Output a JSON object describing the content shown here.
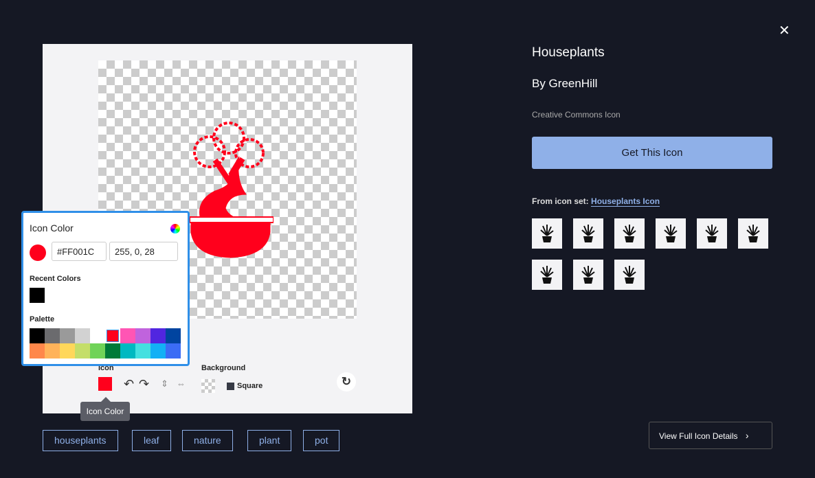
{
  "close_icon": "close-icon",
  "preview": {
    "icon_color": "#FF001C",
    "icon_label": "Icon",
    "background_label": "Background",
    "shape_label": "Square",
    "tooltip": "Icon Color"
  },
  "color_popup": {
    "title": "Icon Color",
    "hex": "#FF001C",
    "rgb": "255, 0, 28",
    "recent_label": "Recent Colors",
    "recent": [
      "#000000"
    ],
    "palette_label": "Palette",
    "palette": [
      "#000000",
      "#6b6b6e",
      "#9a9a9a",
      "#d2d2d2",
      "#ffffff",
      "#ff001c",
      "#ff55b4",
      "#c063dd",
      "#5126e0",
      "#0044a0",
      "#ff874a",
      "#ffb35a",
      "#ffd75a",
      "#c4de69",
      "#70d358",
      "#007a38",
      "#00b9c1",
      "#44e0e0",
      "#12b0f5",
      "#3b6cf5"
    ],
    "selected": "#ff001c"
  },
  "details": {
    "title": "Houseplants",
    "author": "By GreenHill",
    "license": "Creative Commons Icon",
    "get_button": "Get This Icon",
    "set_prefix": "From icon set:",
    "set_link": "Houseplants Icon",
    "thumb_count": 9,
    "view_full": "View Full Icon Details"
  },
  "tags": [
    "houseplants",
    "leaf",
    "nature",
    "plant",
    "pot"
  ],
  "colors": {
    "bg": "#151824",
    "accent": "#8fb0e8",
    "border": "#2f8fe8"
  }
}
